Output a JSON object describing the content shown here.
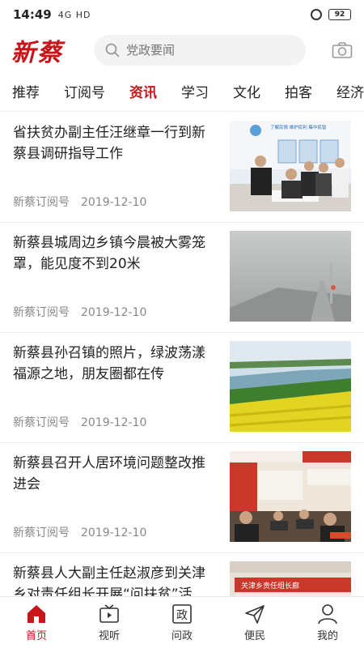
{
  "status": {
    "time": "14:49",
    "signal": "4G HD",
    "battery": "92"
  },
  "header": {
    "logo": "新蔡",
    "search_placeholder": "党政要闻"
  },
  "tabs": [
    "推荐",
    "订阅号",
    "资讯",
    "学习",
    "文化",
    "拍客",
    "经济"
  ],
  "active_tab": "资讯",
  "articles": [
    {
      "title": "省扶贫办副主任汪继章一行到新蔡县调研指导工作",
      "source": "新蔡订阅号",
      "date": "2019-12-10"
    },
    {
      "title": "新蔡县城周边乡镇今晨被大雾笼罩，能见度不到20米",
      "source": "新蔡订阅号",
      "date": "2019-12-10"
    },
    {
      "title": "新蔡县孙召镇的照片，绿波荡漾福源之地，朋友圈都在传",
      "source": "新蔡订阅号",
      "date": "2019-12-10"
    },
    {
      "title": "新蔡县召开人居环境问题整改推进会",
      "source": "新蔡订阅号",
      "date": "2019-12-10"
    },
    {
      "title": "新蔡县人大副主任赵淑彦到关津乡对责任组长开展“问扶贫”活",
      "source": "",
      "date": ""
    }
  ],
  "thumb_text": {
    "banner1": "了解民情  维护民利  集中民智",
    "banner5": "关津乡责任组长廊"
  },
  "bottom_nav": [
    {
      "label": "首页",
      "icon": "home-icon"
    },
    {
      "label": "视听",
      "icon": "tv-icon"
    },
    {
      "label": "问政",
      "icon": "politics-icon"
    },
    {
      "label": "便民",
      "icon": "send-icon"
    },
    {
      "label": "我的",
      "icon": "person-icon"
    }
  ],
  "colors": {
    "accent": "#c8151b"
  }
}
